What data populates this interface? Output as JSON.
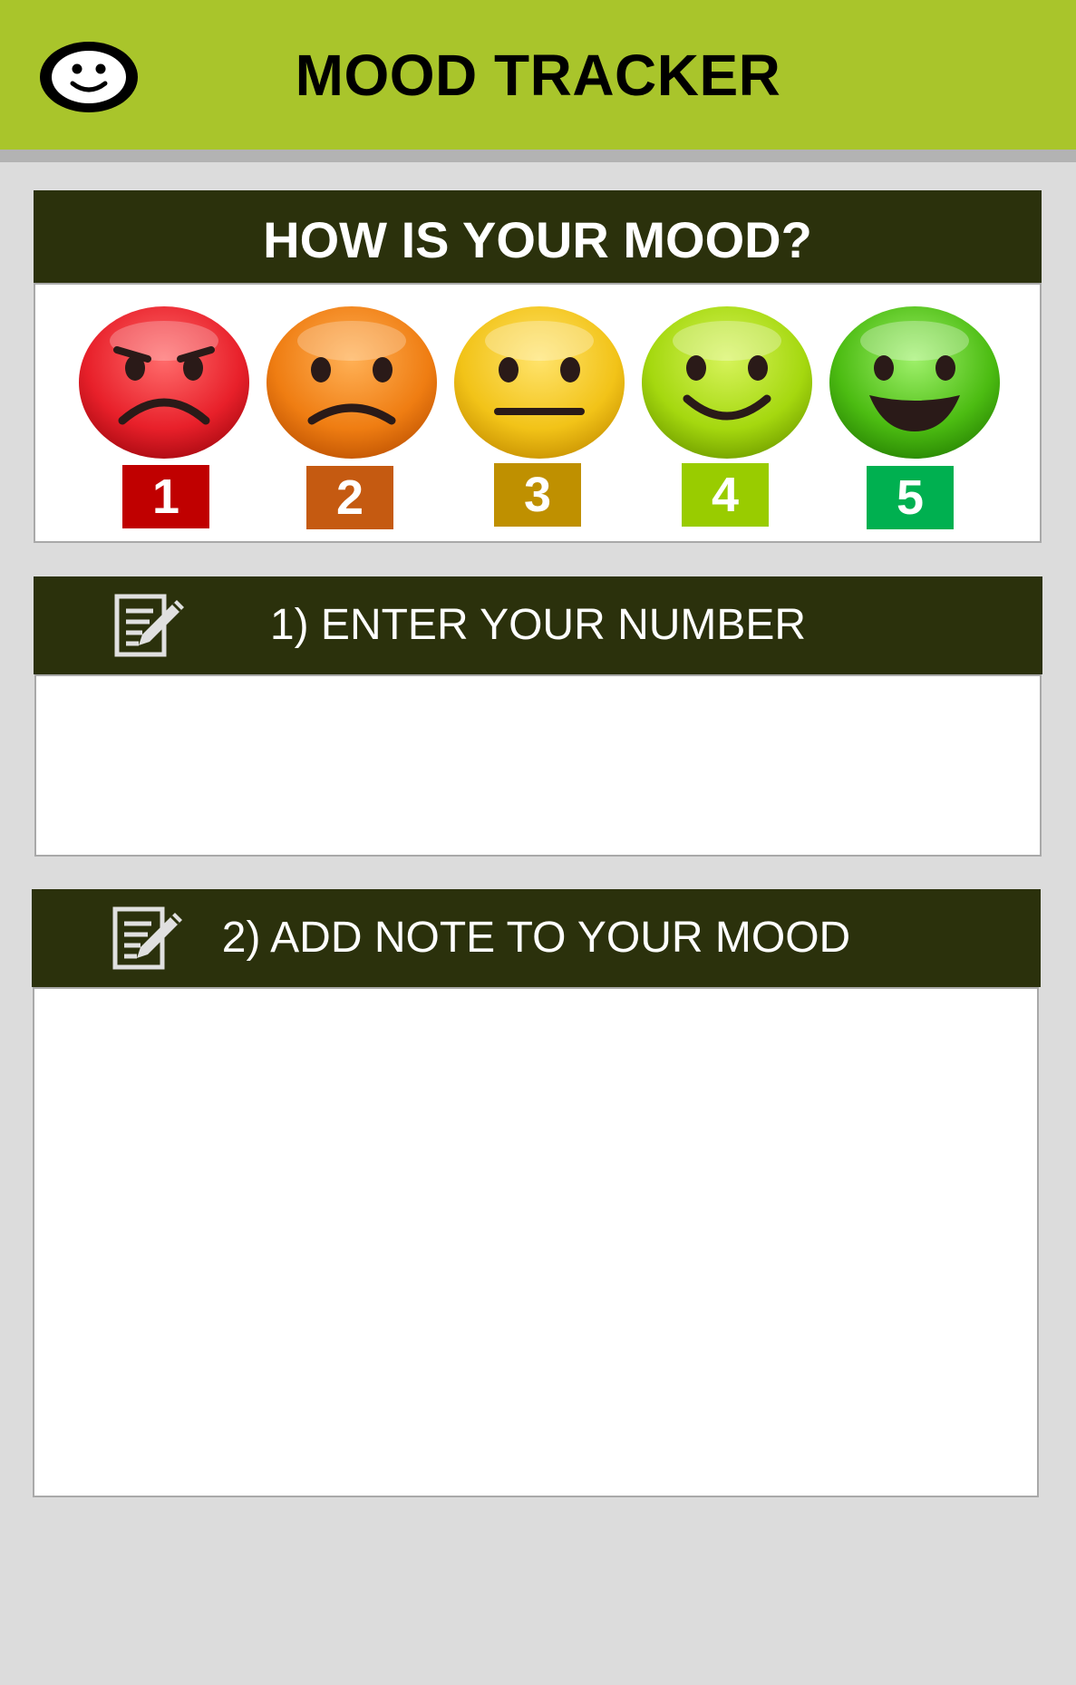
{
  "app": {
    "title": "MOOD TRACKER",
    "icon": "smiley-icon"
  },
  "mood_scale": {
    "heading": "HOW IS YOUR MOOD?",
    "levels": [
      {
        "value": "1",
        "face": "angry-face-icon",
        "color": "#c00000",
        "face_color": "#e8202a"
      },
      {
        "value": "2",
        "face": "sad-face-icon",
        "color": "#c55a11",
        "face_color": "#ef7d12"
      },
      {
        "value": "3",
        "face": "neutral-face-icon",
        "color": "#bf9000",
        "face_color": "#f2c318"
      },
      {
        "value": "4",
        "face": "smiling-face-icon",
        "color": "#99cc00",
        "face_color": "#a5d80f"
      },
      {
        "value": "5",
        "face": "grinning-face-icon",
        "color": "#00b050",
        "face_color": "#4cbc12"
      }
    ]
  },
  "step1": {
    "label": "1) ENTER YOUR NUMBER",
    "icon": "edit-note-icon",
    "value": ""
  },
  "step2": {
    "label": "2) ADD NOTE TO YOUR MOOD",
    "icon": "edit-note-icon",
    "value": ""
  },
  "colors": {
    "appbar": "#a9c52b",
    "header": "#2b310c",
    "background": "#dcdcdc"
  }
}
